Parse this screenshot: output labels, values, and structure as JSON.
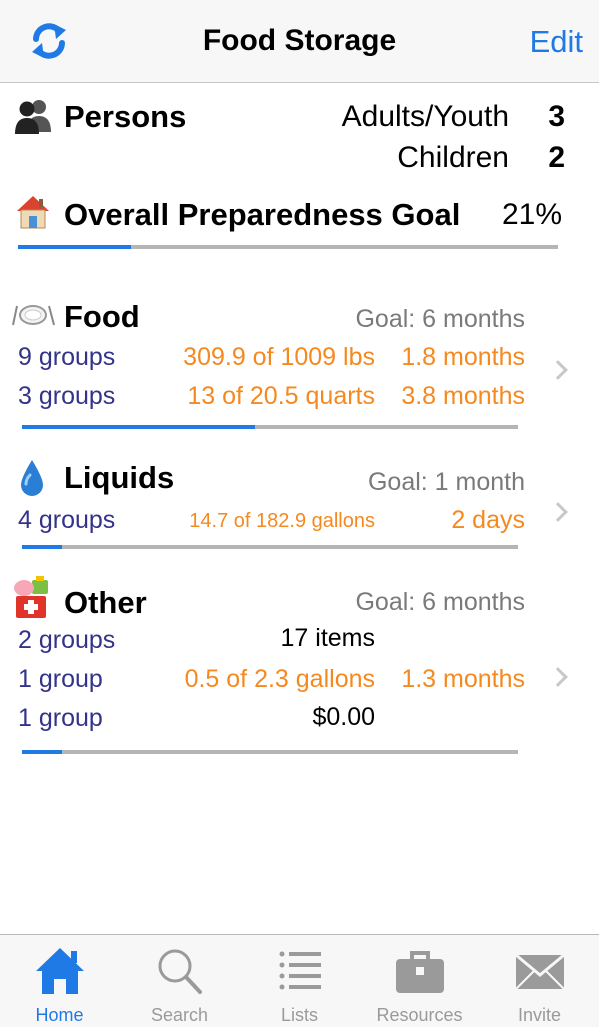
{
  "navbar": {
    "title": "Food Storage",
    "edit_label": "Edit"
  },
  "persons": {
    "label": "Persons",
    "adults_label": "Adults/Youth",
    "adults_value": "3",
    "children_label": "Children",
    "children_value": "2"
  },
  "overall": {
    "label": "Overall Preparedness Goal",
    "percent_text": "21%",
    "progress": 0.21
  },
  "food": {
    "label": "Food",
    "goal": "Goal: 6 months",
    "progress": 0.47,
    "rows": [
      {
        "groups": "9 groups",
        "amount": "309.9 of 1009 lbs",
        "duration": "1.8 months"
      },
      {
        "groups": "3 groups",
        "amount": "13 of 20.5 quarts",
        "duration": "3.8 months"
      }
    ]
  },
  "liquids": {
    "label": "Liquids",
    "goal": "Goal: 1 month",
    "progress": 0.08,
    "rows": [
      {
        "groups": "4 groups",
        "amount": "14.7 of 182.9 gallons",
        "duration": "2 days"
      }
    ]
  },
  "other": {
    "label": "Other",
    "goal": "Goal: 6 months",
    "progress": 0.08,
    "rows": [
      {
        "groups": "2 groups",
        "amount": "17 items"
      },
      {
        "groups": "1 group",
        "amount": "0.5 of 2.3 gallons",
        "duration": "1.3 months"
      },
      {
        "groups": "1 group",
        "amount": "$0.00"
      }
    ]
  },
  "tabs": [
    {
      "label": "Home",
      "icon": "home-icon",
      "active": true
    },
    {
      "label": "Search",
      "icon": "search-icon",
      "active": false
    },
    {
      "label": "Lists",
      "icon": "list-icon",
      "active": false
    },
    {
      "label": "Resources",
      "icon": "briefcase-icon",
      "active": false
    },
    {
      "label": "Invite",
      "icon": "envelope-icon",
      "active": false
    }
  ],
  "colors": {
    "accent": "#1f7ae6",
    "orange": "#f5891f",
    "purple": "#33338a"
  }
}
